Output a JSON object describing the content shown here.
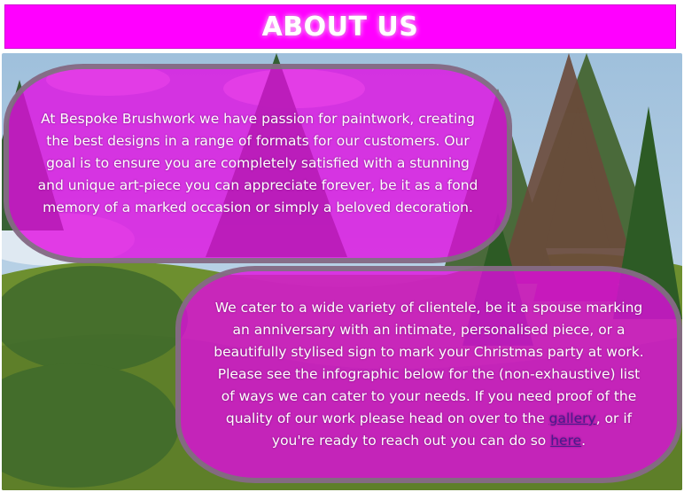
{
  "header": {
    "title": "ABOUT US"
  },
  "colors": {
    "banner": "#ff00ff",
    "panel": "#e10ae1",
    "link": "#4a1a90"
  },
  "background": {
    "image": "painted-pine-trees-landscape"
  },
  "intro": {
    "text": "At Bespoke Brushwork we have passion for paintwork, creating the best designs in a range of formats for our customers. Our goal is to ensure you are completely satisfied with a stunning and unique art-piece you can appreciate forever, be it as a fond memory of a marked occasion or simply a beloved decoration."
  },
  "services": {
    "text_before": "We cater to a wide variety of clientele, be it a spouse marking an anniversary with an intimate, personalised piece, or a beautifully stylised sign to mark your Christmas party at work. Please see the infographic below for the (non-exhaustive) list of ways we can cater to your needs. If you need proof of the quality of our work please head on over to the ",
    "gallery_link": "gallery",
    "text_middle": ", or if you're ready to reach out you can do so ",
    "here_link": "here",
    "text_after": "."
  }
}
